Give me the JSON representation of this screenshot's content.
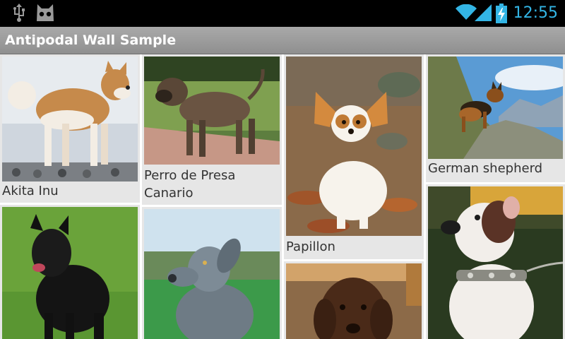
{
  "status": {
    "time": "12:55",
    "accent_color": "#33b5e5",
    "icons": [
      "usb-icon",
      "android-debug-icon",
      "wifi-icon",
      "signal-icon",
      "battery-charging-icon"
    ]
  },
  "app": {
    "title": "Antipodal Wall Sample"
  },
  "dogs": [
    {
      "name": "Akita Inu"
    },
    {
      "name": "Perro de Presa Canario"
    },
    {
      "name": "Papillon"
    },
    {
      "name": "German shepherd"
    },
    {
      "name": ""
    },
    {
      "name": ""
    },
    {
      "name": ""
    },
    {
      "name": ""
    }
  ]
}
